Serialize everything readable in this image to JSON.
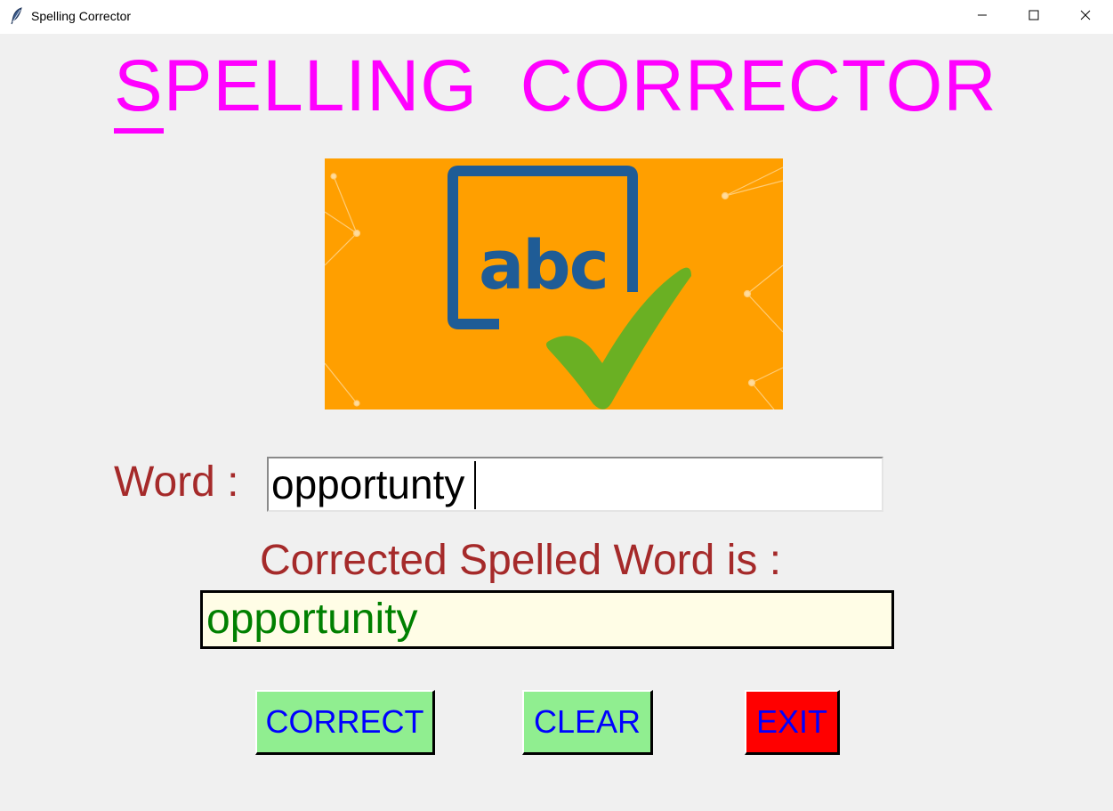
{
  "window": {
    "title": "Spelling Corrector",
    "controls": {
      "minimize_icon": "minimize-icon",
      "maximize_icon": "maximize-icon",
      "close_icon": "close-icon"
    }
  },
  "heading": {
    "first_letter": "S",
    "rest": "PELLING  CORRECTOR",
    "color": "#ff00ff"
  },
  "logo": {
    "text": "abc",
    "icon": "spell-check-icon"
  },
  "word": {
    "label": "Word :",
    "value": "opportunty"
  },
  "result": {
    "label": "Corrected Spelled Word is :",
    "value": "opportunity",
    "value_color": "#008000"
  },
  "buttons": {
    "correct": {
      "label": "CORRECT",
      "bg": "#90ee90"
    },
    "clear": {
      "label": "CLEAR",
      "bg": "#90ee90"
    },
    "exit": {
      "label": "EXIT",
      "bg": "#ff0000"
    }
  },
  "colors": {
    "label": "#a52a2a",
    "button_text": "#0000ff",
    "logo_bg": "#ff9f00"
  }
}
